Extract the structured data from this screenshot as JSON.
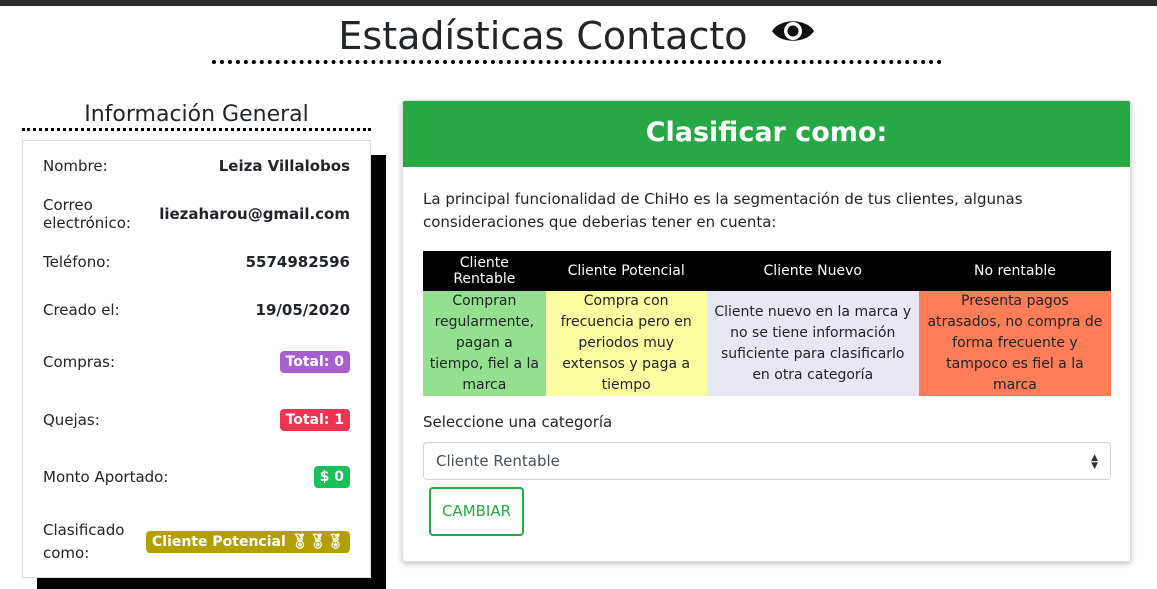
{
  "header": {
    "title": "Estadísticas Contacto",
    "icon": "eye-icon"
  },
  "general": {
    "title": "Información General",
    "rows": {
      "nombre": {
        "label": "Nombre:",
        "value": "Leiza Villalobos"
      },
      "correo": {
        "label": "Correo electrónico:",
        "value": "liezaharou@gmail.com"
      },
      "telefono": {
        "label": "Teléfono:",
        "value": "5574982596"
      },
      "creado": {
        "label": "Creado el:",
        "value": "19/05/2020"
      },
      "compras": {
        "label": "Compras:",
        "badge": "Total: 0"
      },
      "quejas": {
        "label": "Quejas:",
        "badge": "Total: 1"
      },
      "monto": {
        "label": "Monto Aportado:",
        "badge": "$ 0"
      },
      "clasificado": {
        "label_line1": "Clasificado",
        "label_line2": "como:",
        "badge": "Cliente Potencial",
        "badge_icons": [
          "medal-icon",
          "medal-icon",
          "medal-icon"
        ]
      }
    }
  },
  "classify": {
    "title": "Clasificar como:",
    "intro": "La principal funcionalidad de ChiHo es la segmentación de tus clientes, algunas consideraciones que deberias tener en cuenta:",
    "table": {
      "headers": [
        "Cliente Rentable",
        "Cliente Potencial",
        "Cliente Nuevo",
        "No rentable"
      ],
      "descriptions": [
        "Compran regularmente, pagan a tiempo, fiel a la marca",
        "Compra con frecuencia pero en periodos muy extensos y paga a tiempo",
        "Cliente nuevo en la marca y no se tiene información suficiente para clasificarlo en otra categoría",
        "Presenta pagos atrasados, no compra de forma frecuente y tampoco es fiel a la marca"
      ]
    },
    "select_label": "Seleccione una categoría",
    "selected": "Cliente Rentable",
    "button": "CAMBIAR"
  },
  "colors": {
    "accent_green": "#28a745",
    "rentable": "#93e08e",
    "potencial": "#fcfca0",
    "nuevo": "#e7e7f5",
    "no_rentable": "#ff7d58"
  }
}
